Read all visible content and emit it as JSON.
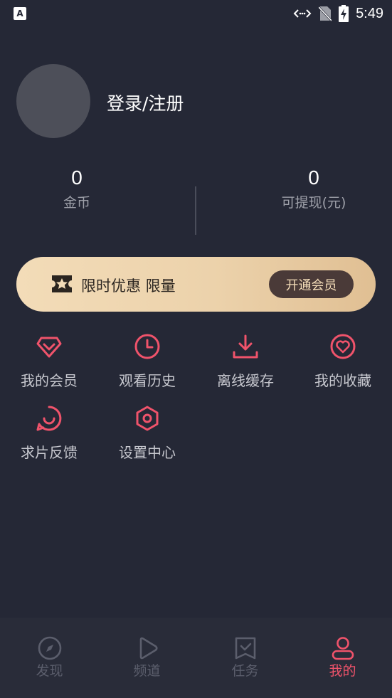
{
  "status_bar": {
    "time": "5:49",
    "app_icon_label": "A"
  },
  "profile": {
    "login_label": "登录/注册"
  },
  "stats": [
    {
      "value": "0",
      "label": "金币"
    },
    {
      "value": "0",
      "label": "可提现(元)"
    }
  ],
  "vip_banner": {
    "text": "限时优惠 限量",
    "button_label": "开通会员"
  },
  "menu": [
    {
      "label": "我的会员",
      "icon": "diamond-icon"
    },
    {
      "label": "观看历史",
      "icon": "clock-icon"
    },
    {
      "label": "离线缓存",
      "icon": "download-icon"
    },
    {
      "label": "我的收藏",
      "icon": "heart-icon"
    },
    {
      "label": "求片反馈",
      "icon": "chat-icon"
    },
    {
      "label": "设置中心",
      "icon": "settings-icon"
    }
  ],
  "tabs": [
    {
      "label": "发现",
      "icon": "compass-icon",
      "active": false
    },
    {
      "label": "频道",
      "icon": "play-icon",
      "active": false
    },
    {
      "label": "任务",
      "icon": "task-icon",
      "active": false
    },
    {
      "label": "我的",
      "icon": "user-icon",
      "active": true
    }
  ],
  "colors": {
    "background": "#252836",
    "accent": "#f0536b",
    "vip_gold": "#f3dcb8",
    "tab_inactive": "#5b5e6c"
  }
}
